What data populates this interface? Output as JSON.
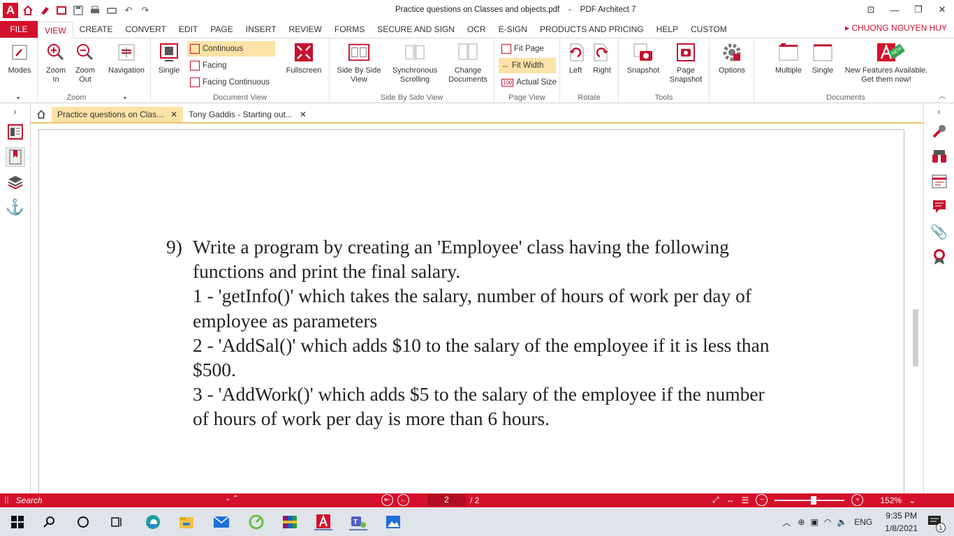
{
  "window": {
    "document_name": "Practice questions on Classes and objects.pdf",
    "separator": "-",
    "app_name": "PDF Architect 7"
  },
  "menu": {
    "tabs": [
      "FILE",
      "VIEW",
      "CREATE",
      "CONVERT",
      "EDIT",
      "PAGE",
      "INSERT",
      "REVIEW",
      "FORMS",
      "SECURE AND SIGN",
      "OCR",
      "E-SIGN",
      "PRODUCTS AND PRICING",
      "HELP",
      "CUSTOM"
    ],
    "active_tab": "VIEW",
    "user": "CHUONG NGUYEN HUY"
  },
  "ribbon": {
    "modes": "Modes",
    "zoom_in": "Zoom In",
    "zoom_out": "Zoom Out",
    "navigation": "Navigation",
    "zoom_group": "Zoom",
    "single": "Single",
    "continuous": "Continuous",
    "facing": "Facing",
    "facing_continuous": "Facing Continuous",
    "fullscreen": "Fullscreen",
    "document_view_group": "Document View",
    "side_by_side_view": "Side By Side View",
    "synchronous_scrolling": "Synchronous Scrolling",
    "change_documents": "Change Documents",
    "side_by_side_group": "Side By Side View",
    "fit_page": "Fit Page",
    "fit_width": "Fit Width",
    "actual_size": "Actual Size",
    "actual_size_icon": "100",
    "page_view_group": "Page View",
    "left": "Left",
    "right": "Right",
    "rotate_group": "Rotate",
    "snapshot": "Snapshot",
    "page_snapshot": "Page Snapshot",
    "tools_group": "Tools",
    "options": "Options",
    "multiple": "Multiple",
    "single_doc": "Single",
    "new_features": "New Features Available. Get them now!",
    "new_badge": "NEW",
    "documents_group": "Documents"
  },
  "doc_tabs": [
    {
      "title": "Practice questions on Clas...",
      "active": true
    },
    {
      "title": "Tony Gaddis - Starting out...",
      "active": false
    }
  ],
  "content": {
    "number": "9)",
    "lines": [
      "Write a program by creating an 'Employee' class having the following",
      "functions and print the final salary.",
      "1 - 'getInfo()' which takes the salary, number of hours of work per day of",
      "employee as parameters",
      "2 - 'AddSal()' which adds $10 to the salary of the employee if it is less than",
      "$500.",
      "3 - 'AddWork()' which adds $5 to the salary of the employee if the number",
      "of hours of work per day is more than 6 hours."
    ]
  },
  "statusbar": {
    "search_label": "Search",
    "current_page": "2",
    "total_pages": "/ 2",
    "zoom": "152%"
  },
  "taskbar": {
    "language": "ENG",
    "time": "9:35 PM",
    "date": "1/8/2021",
    "notifications": "1"
  },
  "colors": {
    "brand_red": "#d4102c",
    "selected": "#fbe2a6",
    "tab_underline": "#f4c36b"
  }
}
